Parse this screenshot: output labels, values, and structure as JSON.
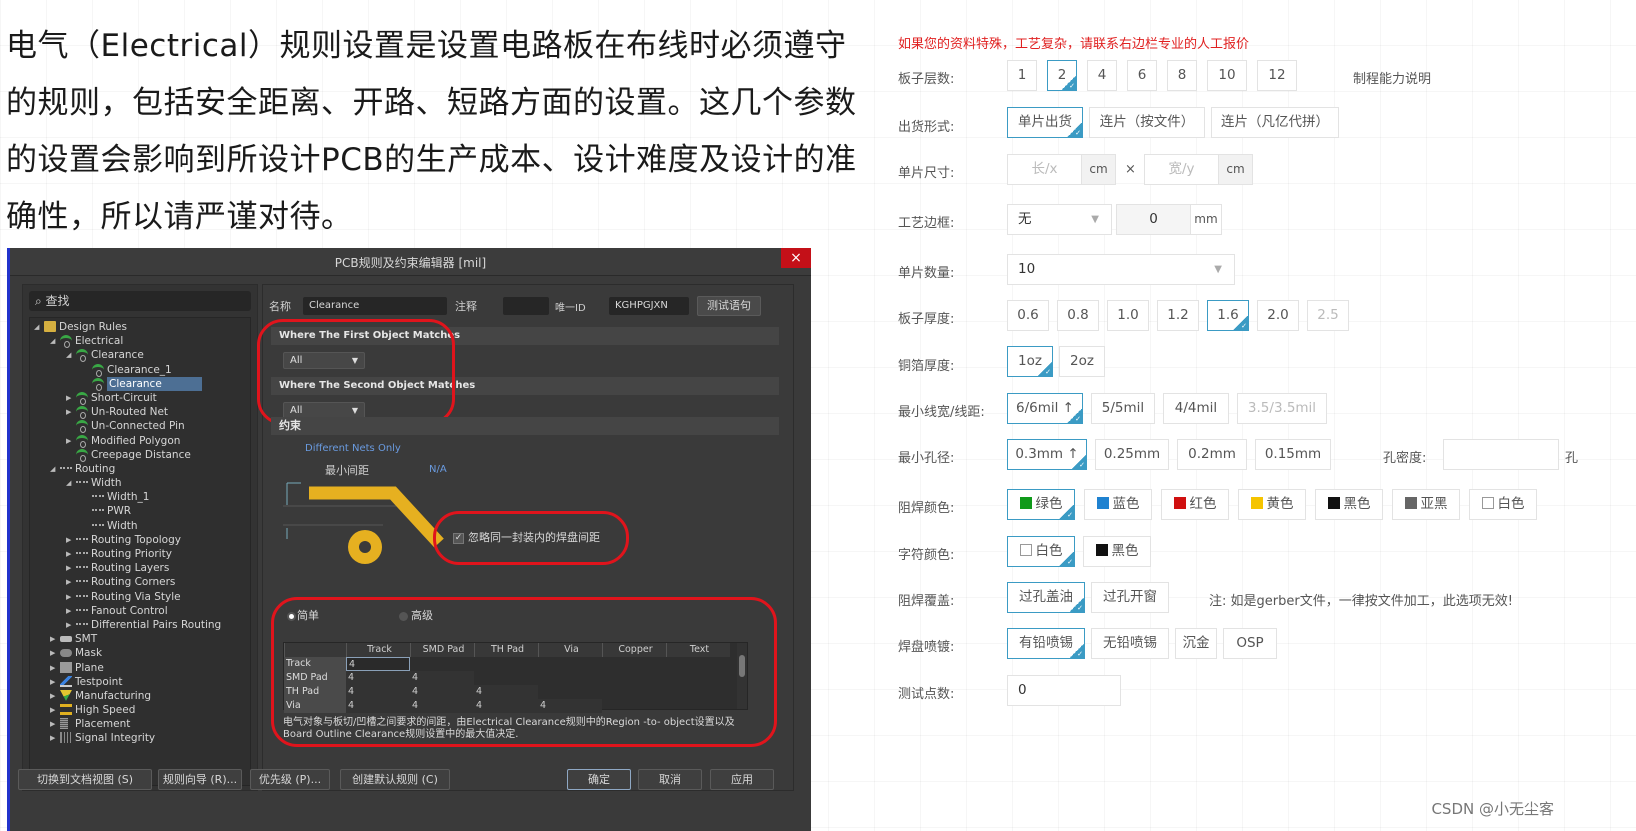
{
  "intro": {
    "text": "电气（Electrical）规则设置是设置电路板在布线时必须遵守的规则，包括安全距离、开路、短路方面的设置。这几个参数的设置会影响到所设计PCB的生产成本、设计难度及设计的准确性，所以请严谨对待。"
  },
  "dialog": {
    "title": "PCB规则及约束编辑器 [mil]",
    "close_icon": "×",
    "search_placeholder": "查找",
    "search_icon": "search-icon",
    "tree": [
      {
        "label": "Design Rules",
        "level": 0,
        "toggle": "expanded",
        "icon": "folder-icon"
      },
      {
        "label": "Electrical",
        "level": 1,
        "toggle": "expanded",
        "icon": "rule-icon"
      },
      {
        "label": "Clearance",
        "level": 2,
        "toggle": "expanded",
        "icon": "rule-icon"
      },
      {
        "label": "Clearance_1",
        "level": 3,
        "toggle": "none",
        "icon": "rule-icon"
      },
      {
        "label": "Clearance",
        "level": 3,
        "toggle": "none",
        "icon": "rule-icon",
        "selected": true
      },
      {
        "label": "Short-Circuit",
        "level": 2,
        "toggle": "collapsed",
        "icon": "rule-icon"
      },
      {
        "label": "Un-Routed Net",
        "level": 2,
        "toggle": "collapsed",
        "icon": "rule-icon"
      },
      {
        "label": "Un-Connected Pin",
        "level": 2,
        "toggle": "none",
        "icon": "rule-icon"
      },
      {
        "label": "Modified Polygon",
        "level": 2,
        "toggle": "collapsed",
        "icon": "rule-icon"
      },
      {
        "label": "Creepage Distance",
        "level": 2,
        "toggle": "none",
        "icon": "rule-icon"
      },
      {
        "label": "Routing",
        "level": 1,
        "toggle": "expanded",
        "icon": "routing-icon"
      },
      {
        "label": "Width",
        "level": 2,
        "toggle": "expanded",
        "icon": "routing-icon"
      },
      {
        "label": "Width_1",
        "level": 3,
        "toggle": "none",
        "icon": "routing-icon"
      },
      {
        "label": "PWR",
        "level": 3,
        "toggle": "none",
        "icon": "routing-icon"
      },
      {
        "label": "Width",
        "level": 3,
        "toggle": "none",
        "icon": "routing-icon"
      },
      {
        "label": "Routing Topology",
        "level": 2,
        "toggle": "collapsed",
        "icon": "routing-icon"
      },
      {
        "label": "Routing Priority",
        "level": 2,
        "toggle": "collapsed",
        "icon": "routing-icon"
      },
      {
        "label": "Routing Layers",
        "level": 2,
        "toggle": "collapsed",
        "icon": "routing-icon"
      },
      {
        "label": "Routing Corners",
        "level": 2,
        "toggle": "collapsed",
        "icon": "routing-icon"
      },
      {
        "label": "Routing Via Style",
        "level": 2,
        "toggle": "collapsed",
        "icon": "routing-icon"
      },
      {
        "label": "Fanout Control",
        "level": 2,
        "toggle": "collapsed",
        "icon": "routing-icon"
      },
      {
        "label": "Differential Pairs Routing",
        "level": 2,
        "toggle": "collapsed",
        "icon": "routing-icon"
      },
      {
        "label": "SMT",
        "level": 1,
        "toggle": "collapsed",
        "icon": "smt-icon"
      },
      {
        "label": "Mask",
        "level": 1,
        "toggle": "collapsed",
        "icon": "mask-icon"
      },
      {
        "label": "Plane",
        "level": 1,
        "toggle": "collapsed",
        "icon": "plane-icon"
      },
      {
        "label": "Testpoint",
        "level": 1,
        "toggle": "collapsed",
        "icon": "testpoint-icon"
      },
      {
        "label": "Manufacturing",
        "level": 1,
        "toggle": "collapsed",
        "icon": "manufacturing-icon"
      },
      {
        "label": "High Speed",
        "level": 1,
        "toggle": "collapsed",
        "icon": "high-speed-icon"
      },
      {
        "label": "Placement",
        "level": 1,
        "toggle": "collapsed",
        "icon": "placement-icon"
      },
      {
        "label": "Signal Integrity",
        "level": 1,
        "toggle": "collapsed",
        "icon": "signal-integrity-icon"
      }
    ],
    "name_label": "名称",
    "name_value": "Clearance",
    "comment_label": "注释",
    "comment_value": "",
    "uid_label": "唯一ID",
    "uid_value": "KGHPGJXN",
    "test_button": "测试语句",
    "first_match_header": "Where The First Object Matches",
    "first_match_value": "All",
    "second_match_header": "Where The Second Object Matches",
    "second_match_value": "All",
    "constraints_header": "约束",
    "different_nets": "Different Nets Only",
    "min_clearance_label": "最小间距",
    "min_clearance_value": "N/A",
    "ignore_pads_label": "忽略同一封装内的焊盘间距",
    "ignore_pads_checked": true,
    "mode_simple": "简单",
    "mode_advanced": "高级",
    "mode_selected": "simple",
    "grid": {
      "columns": [
        "",
        "Track",
        "SMD Pad",
        "TH Pad",
        "Via",
        "Copper",
        "Text"
      ],
      "rows": [
        {
          "header": "Track",
          "values": [
            "4",
            "",
            "",
            "",
            "",
            ""
          ]
        },
        {
          "header": "SMD Pad",
          "values": [
            "4",
            "4",
            "",
            "",
            "",
            ""
          ]
        },
        {
          "header": "TH Pad",
          "values": [
            "4",
            "4",
            "4",
            "",
            "",
            ""
          ]
        },
        {
          "header": "Via",
          "values": [
            "4",
            "4",
            "4",
            "4",
            "",
            ""
          ]
        }
      ]
    },
    "note": "电气对象与板切/凹槽之间要求的间距，由Electrical Clearance规则中的Region -to- object设置以及Board Outline Clearance规则设置中的最大值决定.",
    "footer": {
      "switch_view": "切换到文档视图 (S)",
      "rule_wizard": "规则向导 (R)...",
      "priority": "优先级 (P)...",
      "create_default": "创建默认规则 (C)",
      "ok": "确定",
      "cancel": "取消",
      "apply": "应用"
    }
  },
  "form": {
    "notice": "如果您的资料特殊，工艺复杂，请联系右边栏专业的人工报价",
    "process_capability_link": "制程能力说明",
    "layers": {
      "label": "板子层数:",
      "options": [
        "1",
        "2",
        "4",
        "6",
        "8",
        "10",
        "12"
      ],
      "selected": "2"
    },
    "delivery": {
      "label": "出货形式:",
      "options": [
        "单片出货",
        "连片（按文件）",
        "连片（凡亿代拼）"
      ],
      "selected": "单片出货"
    },
    "size": {
      "label": "单片尺寸:",
      "x_placeholder": "长/x",
      "y_placeholder": "宽/y",
      "unit": "cm",
      "times": "×"
    },
    "border": {
      "label": "工艺边框:",
      "select_value": "无",
      "input_value": "0",
      "unit": "mm"
    },
    "quantity": {
      "label": "单片数量:",
      "value": "10"
    },
    "thickness": {
      "label": "板子厚度:",
      "options": [
        "0.6",
        "0.8",
        "1.0",
        "1.2",
        "1.6",
        "2.0",
        "2.5"
      ],
      "selected": "1.6",
      "disabled": [
        "2.5"
      ]
    },
    "copper": {
      "label": "铜箔厚度:",
      "options": [
        "1oz",
        "2oz"
      ],
      "selected": "1oz"
    },
    "trace": {
      "label": "最小线宽/线距:",
      "options": [
        "6/6mil ↑",
        "5/5mil",
        "4/4mil",
        "3.5/3.5mil"
      ],
      "selected": "6/6mil ↑",
      "disabled": [
        "3.5/3.5mil"
      ]
    },
    "hole": {
      "label": "最小孔径:",
      "options": [
        "0.3mm ↑",
        "0.25mm",
        "0.2mm",
        "0.15mm"
      ],
      "selected": "0.3mm ↑",
      "density_label": "孔密度:",
      "density_value": "",
      "trailing_char": "孔"
    },
    "mask_color": {
      "label": "阻焊颜色:",
      "options": [
        {
          "label": "绿色",
          "color": "#109a1a"
        },
        {
          "label": "蓝色",
          "color": "#1f82d0"
        },
        {
          "label": "红色",
          "color": "#d01010"
        },
        {
          "label": "黄色",
          "color": "#f5c400"
        },
        {
          "label": "黑色",
          "color": "#111111"
        },
        {
          "label": "亚黑",
          "color": "#666666"
        },
        {
          "label": "白色",
          "color": "#ffffff"
        }
      ],
      "selected": "绿色"
    },
    "silk_color": {
      "label": "字符颜色:",
      "options": [
        {
          "label": "白色",
          "color": "#ffffff"
        },
        {
          "label": "黑色",
          "color": "#111111"
        }
      ],
      "selected": "白色"
    },
    "mask_cover": {
      "label": "阻焊覆盖:",
      "options": [
        "过孔盖油",
        "过孔开窗"
      ],
      "selected": "过孔盖油",
      "note": "注: 如是gerber文件，一律按文件加工，此选项无效!"
    },
    "finish": {
      "label": "焊盘喷镀:",
      "options": [
        "有铅喷锡",
        "无铅喷锡",
        "沉金",
        "OSP"
      ],
      "selected": "有铅喷锡"
    },
    "test_points": {
      "label": "测试点数:",
      "value": "0"
    }
  },
  "credit": "CSDN @小无尘客",
  "colors": {
    "accent": "#3b9bc4",
    "highlight_ring": "#e0141c",
    "notice": "#e02020",
    "trace_gold": "#e6b020"
  }
}
